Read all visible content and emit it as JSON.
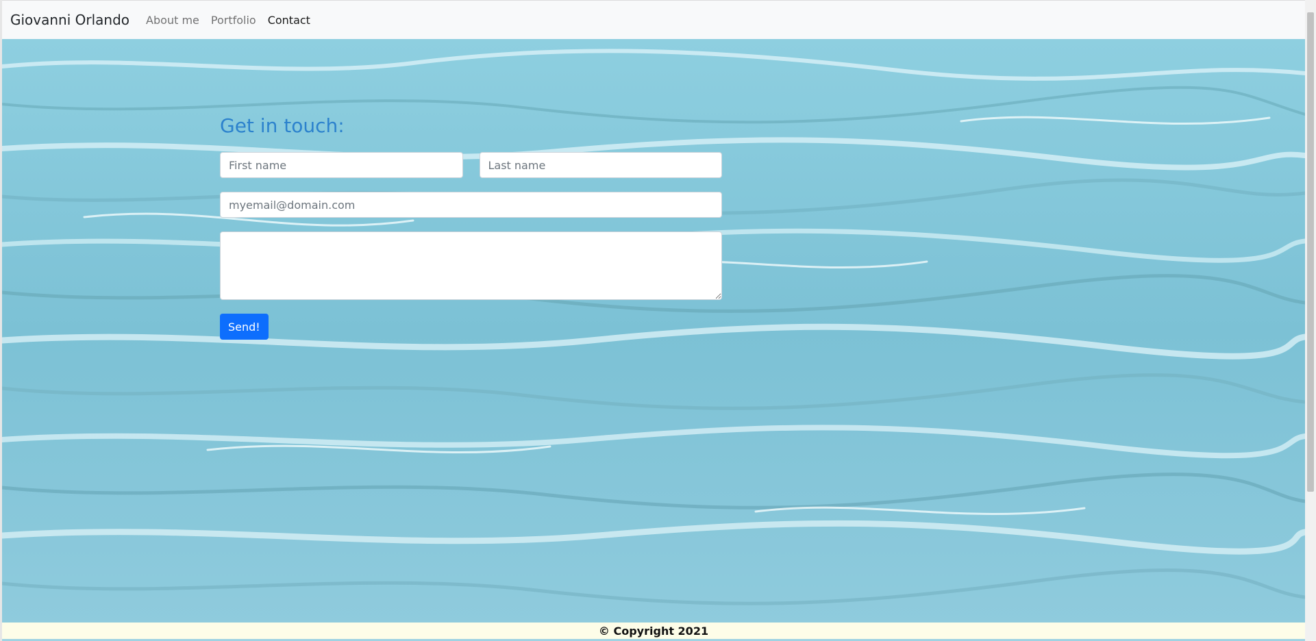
{
  "nav": {
    "brand": "Giovanni Orlando",
    "links": [
      "About me",
      "Portfolio",
      "Contact"
    ]
  },
  "form": {
    "title": "Get in touch:",
    "first_name_placeholder": "First name",
    "last_name_placeholder": "Last name",
    "email_placeholder": "myemail@domain.com",
    "message_placeholder": "",
    "submit_label": "Send!"
  },
  "footer": {
    "text": "© Copyright 2021"
  },
  "colors": {
    "title": "#2c82cd",
    "button": "#0d6efd",
    "footer_bg": "#fdfde8"
  }
}
